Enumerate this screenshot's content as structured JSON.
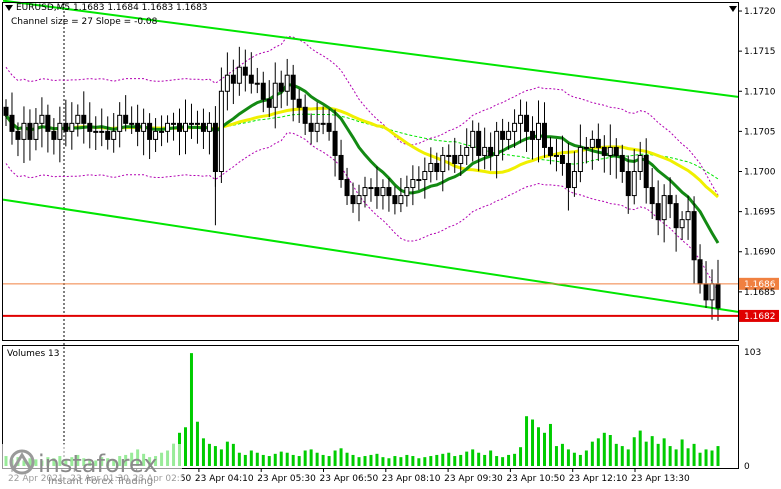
{
  "header": {
    "title_line": "EURUSD,M5  1.1683 1.1684 1.1683 1.1683",
    "channel_line": "Channel size = 27 Slope = -0.08"
  },
  "volumes_label": "Volumes 13",
  "logo": {
    "brand": "instaforex",
    "tagline": "Instant Forex Trading"
  },
  "colors": {
    "candle": "#000000",
    "channel": "#00e600",
    "ma_fast": "#138a13",
    "ma_slow": "#f0f000",
    "bands": "#b200b2",
    "volume": "#00cc00",
    "volume_up": "#ff0000",
    "price_line_orange": "#f08040",
    "price_line_red": "#e00000"
  },
  "chart_data": {
    "type": "candlestick",
    "symbol": "EURUSD",
    "timeframe": "M5",
    "ohlc_header": [
      1.1683,
      1.1684,
      1.1683,
      1.1683
    ],
    "channel_size": 27,
    "slope": -0.08,
    "price_axis": {
      "range": [
        1.1679,
        1.1721
      ],
      "ticks": [
        "1.1720",
        "1.1715",
        "1.1710",
        "1.1705",
        "1.1700",
        "1.1695",
        "1.1690",
        "1.1685"
      ]
    },
    "price_labels": [
      {
        "value": 1.1686,
        "text": "1.1686",
        "color": "#f08040"
      },
      {
        "value": 1.1682,
        "text": "1.1682",
        "color": "#e00000"
      }
    ],
    "volume_axis": {
      "range": [
        0,
        103
      ],
      "ticks": [
        "103",
        "0"
      ]
    },
    "time_labels": [
      "22 Apr 2021",
      "23 Apr 01:30",
      "23 Apr 02:50",
      "23 Apr 04:10",
      "23 Apr 05:30",
      "23 Apr 06:50",
      "23 Apr 08:10",
      "23 Apr 09:30",
      "23 Apr 10:50",
      "23 Apr 12:10",
      "23 Apr 13:30"
    ],
    "channel_upper": [
      1.17213,
      1.17093
    ],
    "channel_lower": [
      1.16965,
      1.16825
    ],
    "close": [
      1.1707,
      1.1705,
      1.1704,
      1.1706,
      1.1704,
      1.1706,
      1.1707,
      1.1705,
      1.1704,
      1.1706,
      1.1705,
      1.1706,
      1.1707,
      1.1706,
      1.1705,
      1.1705,
      1.1705,
      1.1704,
      1.1705,
      1.1707,
      1.1706,
      1.1706,
      1.1705,
      1.1706,
      1.1704,
      1.1705,
      1.1705,
      1.1706,
      1.1706,
      1.1705,
      1.1706,
      1.1706,
      1.1706,
      1.1705,
      1.1706,
      1.17,
      1.171,
      1.1712,
      1.1711,
      1.1713,
      1.1712,
      1.1711,
      1.1711,
      1.1709,
      1.1708,
      1.1711,
      1.171,
      1.1712,
      1.1709,
      1.1708,
      1.1706,
      1.1705,
      1.1706,
      1.1706,
      1.1705,
      1.1702,
      1.1699,
      1.1697,
      1.1696,
      1.1697,
      1.1698,
      1.1698,
      1.1697,
      1.1698,
      1.1697,
      1.1696,
      1.1697,
      1.1698,
      1.1699,
      1.1699,
      1.17,
      1.1701,
      1.17,
      1.1702,
      1.1702,
      1.1701,
      1.1702,
      1.1703,
      1.1705,
      1.1702,
      1.1703,
      1.1702,
      1.1705,
      1.1704,
      1.1705,
      1.1706,
      1.1707,
      1.1705,
      1.1704,
      1.1706,
      1.1703,
      1.1702,
      1.1702,
      1.1701,
      1.1698,
      1.17,
      1.1703,
      1.1703,
      1.1704,
      1.1703,
      1.1702,
      1.1703,
      1.1702,
      1.17,
      1.1697,
      1.17,
      1.1702,
      1.1698,
      1.1696,
      1.1694,
      1.1697,
      1.1696,
      1.1693,
      1.1694,
      1.1695,
      1.1689,
      1.1686,
      1.1684,
      1.1686,
      1.1683
    ],
    "volumes": [
      9,
      6,
      8,
      5,
      7,
      6,
      5,
      8,
      7,
      9,
      6,
      8,
      10,
      7,
      6,
      5,
      8,
      7,
      6,
      9,
      10,
      12,
      15,
      11,
      8,
      9,
      12,
      14,
      20,
      30,
      35,
      102,
      40,
      25,
      20,
      18,
      15,
      22,
      20,
      12,
      10,
      14,
      12,
      10,
      9,
      11,
      13,
      12,
      10,
      9,
      14,
      15,
      12,
      10,
      9,
      14,
      16,
      12,
      10,
      8,
      9,
      10,
      11,
      8,
      7,
      9,
      8,
      10,
      9,
      7,
      8,
      9,
      10,
      11,
      12,
      9,
      10,
      13,
      15,
      12,
      10,
      14,
      9,
      8,
      10,
      11,
      17,
      45,
      42,
      35,
      30,
      38,
      18,
      20,
      15,
      12,
      10,
      14,
      22,
      25,
      30,
      28,
      20,
      18,
      15,
      26,
      32,
      22,
      27,
      20,
      25,
      18,
      15,
      24,
      16,
      20,
      12,
      15,
      14,
      18
    ]
  }
}
